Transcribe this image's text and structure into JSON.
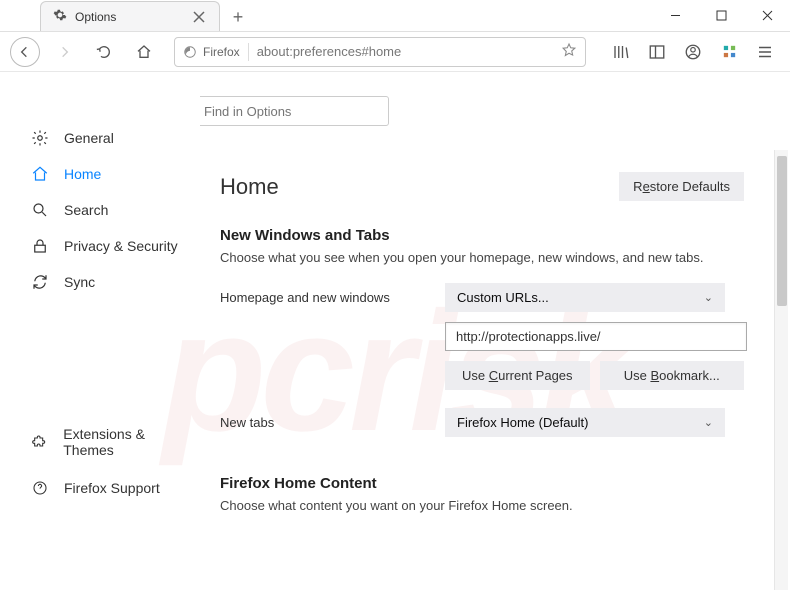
{
  "tab": {
    "title": "Options"
  },
  "url": {
    "identity": "Firefox",
    "address": "about:preferences#home"
  },
  "find": {
    "placeholder": "Find in Options"
  },
  "sidebar": {
    "items": [
      {
        "label": "General"
      },
      {
        "label": "Home"
      },
      {
        "label": "Search"
      },
      {
        "label": "Privacy & Security"
      },
      {
        "label": "Sync"
      }
    ],
    "bottom": [
      {
        "label": "Extensions & Themes"
      },
      {
        "label": "Firefox Support"
      }
    ]
  },
  "page": {
    "heading": "Home",
    "restore_defaults_pre": "R",
    "restore_defaults_ul": "e",
    "restore_defaults_post": "store Defaults",
    "section1": {
      "title": "New Windows and Tabs",
      "desc": "Choose what you see when you open your homepage, new windows, and new tabs.",
      "row1_label": "Homepage and new windows",
      "row1_select": "Custom URLs...",
      "row1_input": "http://protectionapps.live/",
      "btn_current_pre": "Use ",
      "btn_current_ul": "C",
      "btn_current_post": "urrent Pages",
      "btn_bookmark_pre": "Use ",
      "btn_bookmark_ul": "B",
      "btn_bookmark_post": "ookmark...",
      "row2_label": "New tabs",
      "row2_select": "Firefox Home (Default)"
    },
    "section2": {
      "title": "Firefox Home Content",
      "desc": "Choose what content you want on your Firefox Home screen."
    }
  }
}
